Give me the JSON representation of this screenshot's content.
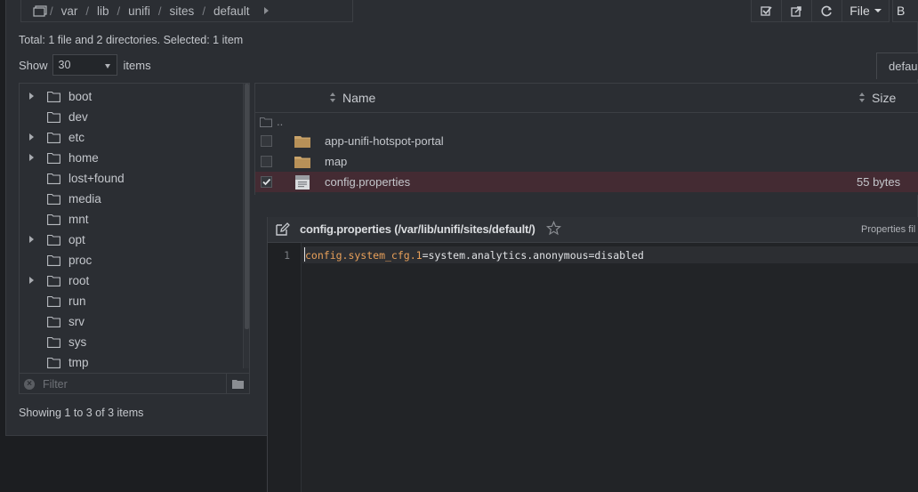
{
  "breadcrumb": [
    "var",
    "lib",
    "unifi",
    "sites",
    "default"
  ],
  "toolbar": {
    "file_label": "File",
    "partial_label": "B"
  },
  "summary": "Total: 1 file and 2 directories. Selected: 1 item",
  "show": {
    "prefix": "Show",
    "value": "30",
    "suffix": "items"
  },
  "tab_label": "defau",
  "tree": {
    "items": [
      {
        "label": "boot",
        "expandable": true
      },
      {
        "label": "dev",
        "expandable": false
      },
      {
        "label": "etc",
        "expandable": true
      },
      {
        "label": "home",
        "expandable": true
      },
      {
        "label": "lost+found",
        "expandable": false
      },
      {
        "label": "media",
        "expandable": false
      },
      {
        "label": "mnt",
        "expandable": false
      },
      {
        "label": "opt",
        "expandable": true
      },
      {
        "label": "proc",
        "expandable": false
      },
      {
        "label": "root",
        "expandable": true
      },
      {
        "label": "run",
        "expandable": false
      },
      {
        "label": "srv",
        "expandable": false
      },
      {
        "label": "sys",
        "expandable": false
      },
      {
        "label": "tmp",
        "expandable": false
      }
    ],
    "filter_placeholder": "Filter"
  },
  "showing": "Showing 1 to 3 of 3 items",
  "files": {
    "col_name": "Name",
    "col_size": "Size",
    "up_label": "..",
    "rows": [
      {
        "name": "app-unifi-hotspot-portal",
        "size": "",
        "type": "folder",
        "checked": false
      },
      {
        "name": "map",
        "size": "",
        "type": "folder",
        "checked": false
      },
      {
        "name": "config.properties",
        "size": "55 bytes",
        "type": "file",
        "checked": true
      }
    ]
  },
  "editor": {
    "title": "config.properties (/var/lib/unifi/sites/default/)",
    "mode": "Properties fil",
    "line_number": "1",
    "code_key": "config.system_cfg.1",
    "code_rest": "=system.analytics.anonymous=disabled"
  },
  "colors": {
    "folder": "#c9a36a",
    "key": "#e8a05a",
    "selected_row": "#442b33"
  }
}
